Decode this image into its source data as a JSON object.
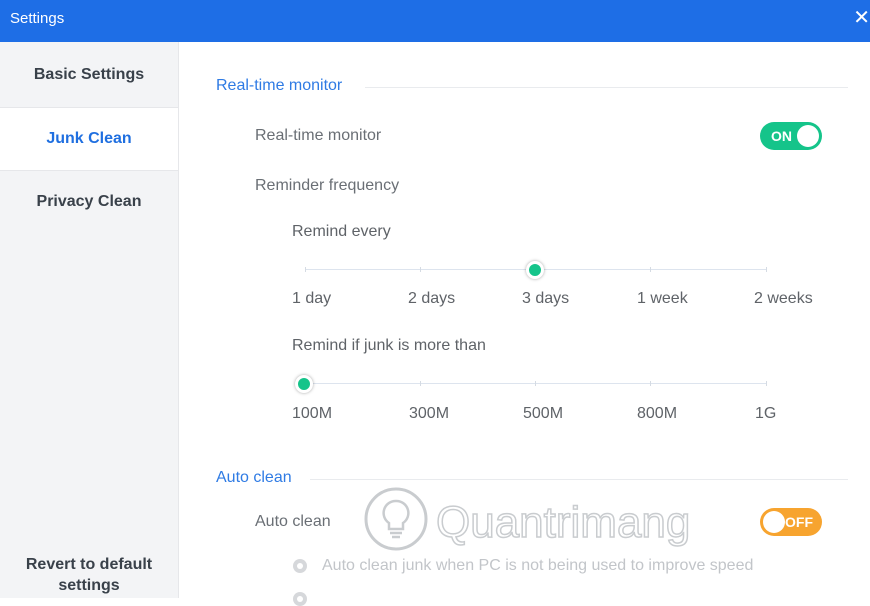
{
  "window": {
    "title": "Settings",
    "close_glyph": "✕"
  },
  "sidebar": {
    "items": [
      {
        "label": "Basic Settings",
        "active": false
      },
      {
        "label": "Junk Clean",
        "active": true
      },
      {
        "label": "Privacy Clean",
        "active": false
      }
    ],
    "revert_label_line1": "Revert to default",
    "revert_label_line2": "settings"
  },
  "realtime": {
    "section_title": "Real-time monitor",
    "toggle_label": "Real-time monitor",
    "toggle_state": "ON",
    "reminder_frequency_label": "Reminder frequency",
    "remind_every_label": "Remind every",
    "remind_every_options": [
      "1 day",
      "2 days",
      "3 days",
      "1 week",
      "2 weeks"
    ],
    "remind_every_selected": "3 days",
    "junk_threshold_label": "Remind if junk is more than",
    "junk_threshold_options": [
      "100M",
      "300M",
      "500M",
      "800M",
      "1G"
    ],
    "junk_threshold_selected": "100M"
  },
  "autoclean": {
    "section_title": "Auto clean",
    "toggle_label": "Auto clean",
    "toggle_state": "OFF",
    "option1_label": "Auto clean junk when PC is not being used to improve speed"
  },
  "watermark": {
    "text": "Quantrimang",
    "icon": "lightbulb-icon"
  },
  "colors": {
    "accent": "#1e6ee6",
    "on": "#15c48a",
    "off": "#f7a42f"
  }
}
